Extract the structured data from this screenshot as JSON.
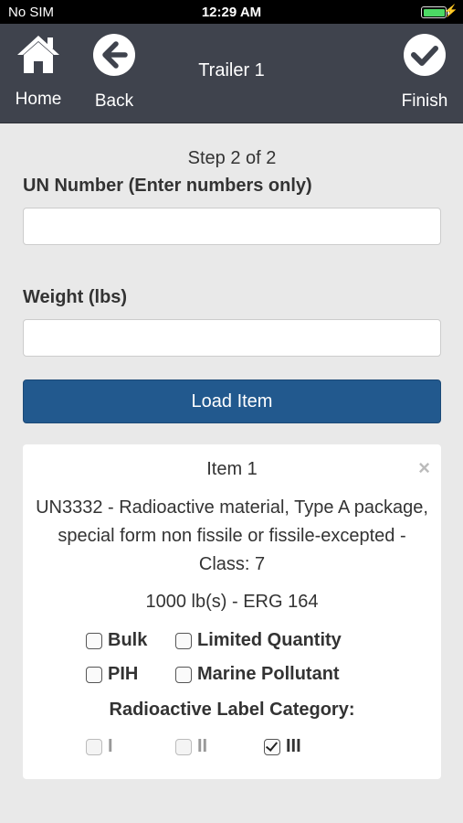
{
  "status": {
    "carrier": "No SIM",
    "time": "12:29 AM"
  },
  "nav": {
    "home_label": "Home",
    "back_label": "Back",
    "title": "Trailer 1",
    "finish_label": "Finish"
  },
  "form": {
    "step": "Step 2 of 2",
    "un_label": "UN Number (Enter numbers only)",
    "un_value": "",
    "weight_label": "Weight (lbs)",
    "weight_value": "",
    "load_button": "Load Item"
  },
  "item": {
    "title": "Item 1",
    "close": "×",
    "description": "UN3332 - Radioactive material, Type A package, special form non fissile or fissile-excepted - Class: 7",
    "weight_erg": "1000 lb(s) - ERG 164",
    "options": {
      "bulk": {
        "label": "Bulk",
        "checked": false
      },
      "limited_quantity": {
        "label": "Limited Quantity",
        "checked": false
      },
      "pih": {
        "label": "PIH",
        "checked": false
      },
      "marine_pollutant": {
        "label": "Marine Pollutant",
        "checked": false
      }
    },
    "category_label": "Radioactive Label Category:",
    "categories": [
      {
        "label": "I",
        "checked": false
      },
      {
        "label": "II",
        "checked": false
      },
      {
        "label": "III",
        "checked": true
      }
    ]
  },
  "colors": {
    "navbar": "#3f434d",
    "primary_button": "#22598e",
    "background": "#e9e9e9",
    "battery": "#4cd964"
  }
}
